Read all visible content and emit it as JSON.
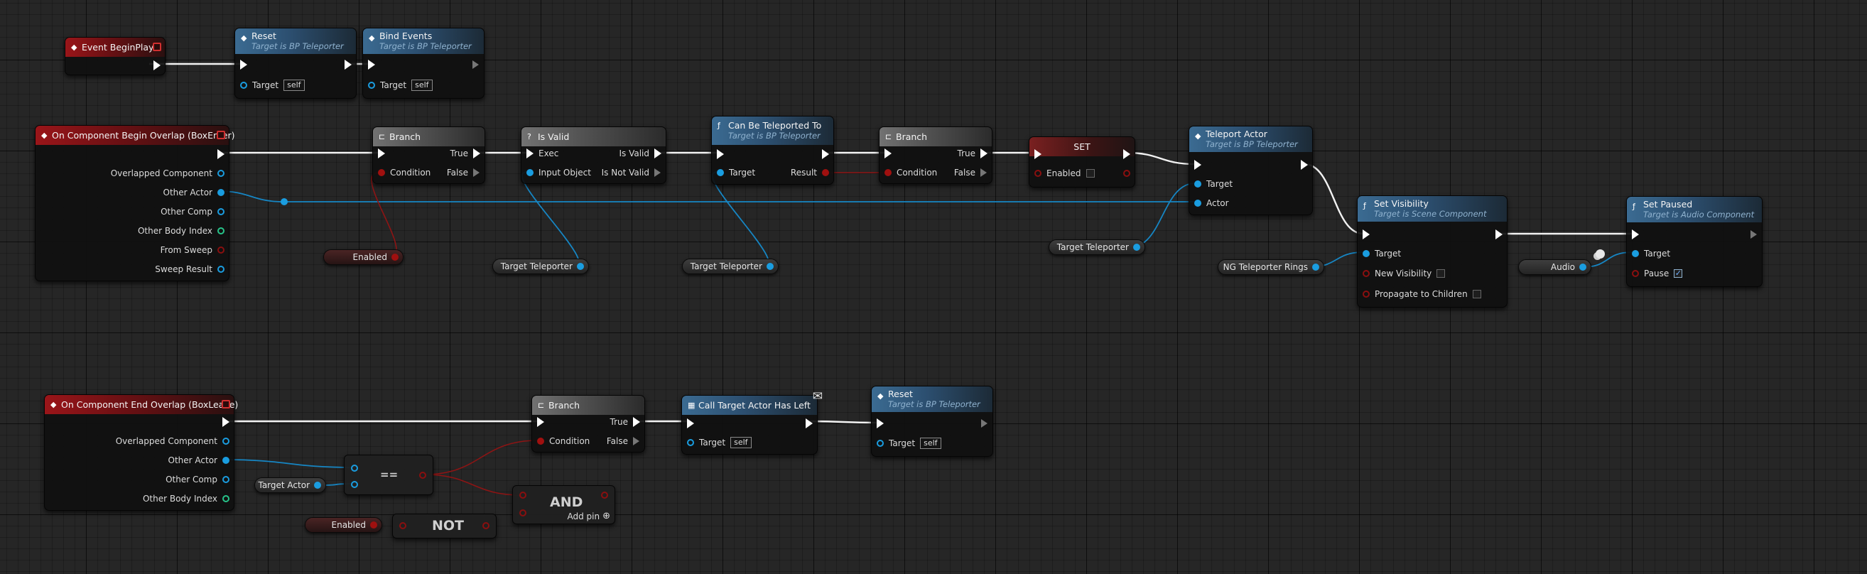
{
  "colors": {
    "event_header": "#9a1519",
    "function_header": "#3b6b92",
    "macro_header": "#727272",
    "object_pin": "#1a9de0",
    "bool_pin": "#a0100f",
    "struct_pin": "#27c48a",
    "exec_pin": "#ffffff",
    "exec_wire": "#f2f2f2",
    "object_wire": "#1686c4",
    "bool_wire": "#8e1414"
  },
  "nodes": {
    "begin_play": {
      "title": "Event BeginPlay"
    },
    "reset_top": {
      "title": "Reset",
      "subtitle": "Target is BP Teleporter",
      "target_label": "Target",
      "target_value": "self"
    },
    "bind_events": {
      "title": "Bind Events",
      "subtitle": "Target is BP Teleporter",
      "target_label": "Target",
      "target_value": "self"
    },
    "begin_overlap": {
      "title": "On Component Begin Overlap (BoxEnter)",
      "pins": [
        "Overlapped Component",
        "Other Actor",
        "Other Comp",
        "Other Body Index",
        "From Sweep",
        "Sweep Result"
      ]
    },
    "branch1": {
      "title": "Branch",
      "condition": "Condition",
      "true_label": "True",
      "false_label": "False"
    },
    "is_valid": {
      "title": "Is Valid",
      "exec": "Exec",
      "input": "Input Object",
      "is_valid": "Is Valid",
      "is_not_valid": "Is Not Valid"
    },
    "can_teleport": {
      "title": "Can Be Teleported To",
      "subtitle": "Target is BP Teleporter",
      "target_label": "Target",
      "result": "Result"
    },
    "branch2": {
      "title": "Branch",
      "condition": "Condition",
      "true_label": "True",
      "false_label": "False"
    },
    "set_node": {
      "title": "SET",
      "label": "Enabled"
    },
    "teleport_actor": {
      "title": "Teleport Actor",
      "subtitle": "Target is BP Teleporter",
      "target_label": "Target",
      "actor_label": "Actor"
    },
    "set_visibility": {
      "title": "Set Visibility",
      "subtitle": "Target is Scene Component",
      "target_label": "Target",
      "new_visibility": "New Visibility",
      "propagate": "Propagate to Children"
    },
    "set_paused": {
      "title": "Set Paused",
      "subtitle": "Target is Audio Component",
      "target_label": "Target",
      "pause_label": "Pause",
      "pause_checked": true
    },
    "end_overlap": {
      "title": "On Component End Overlap (BoxLeave)",
      "pins": [
        "Overlapped Component",
        "Other Actor",
        "Other Comp",
        "Other Body Index"
      ]
    },
    "branch3": {
      "title": "Branch",
      "condition": "Condition",
      "true_label": "True",
      "false_label": "False"
    },
    "call_target": {
      "title": "Call Target Actor Has Left",
      "target_label": "Target",
      "target_value": "self"
    },
    "reset_bottom": {
      "title": "Reset",
      "subtitle": "Target is BP Teleporter",
      "target_label": "Target",
      "target_value": "self"
    },
    "equals": {
      "symbol": "=="
    },
    "not_node": {
      "symbol": "NOT"
    },
    "and_node": {
      "symbol": "AND",
      "add_pin": "Add pin"
    }
  },
  "variables": {
    "enabled_1": "Enabled",
    "target_teleporter_1": "Target Teleporter",
    "target_teleporter_2": "Target Teleporter",
    "target_teleporter_3": "Target Teleporter",
    "ng_rings": "NG Teleporter Rings",
    "audio": "Audio",
    "target_actor": "Target Actor",
    "enabled_2": "Enabled"
  }
}
